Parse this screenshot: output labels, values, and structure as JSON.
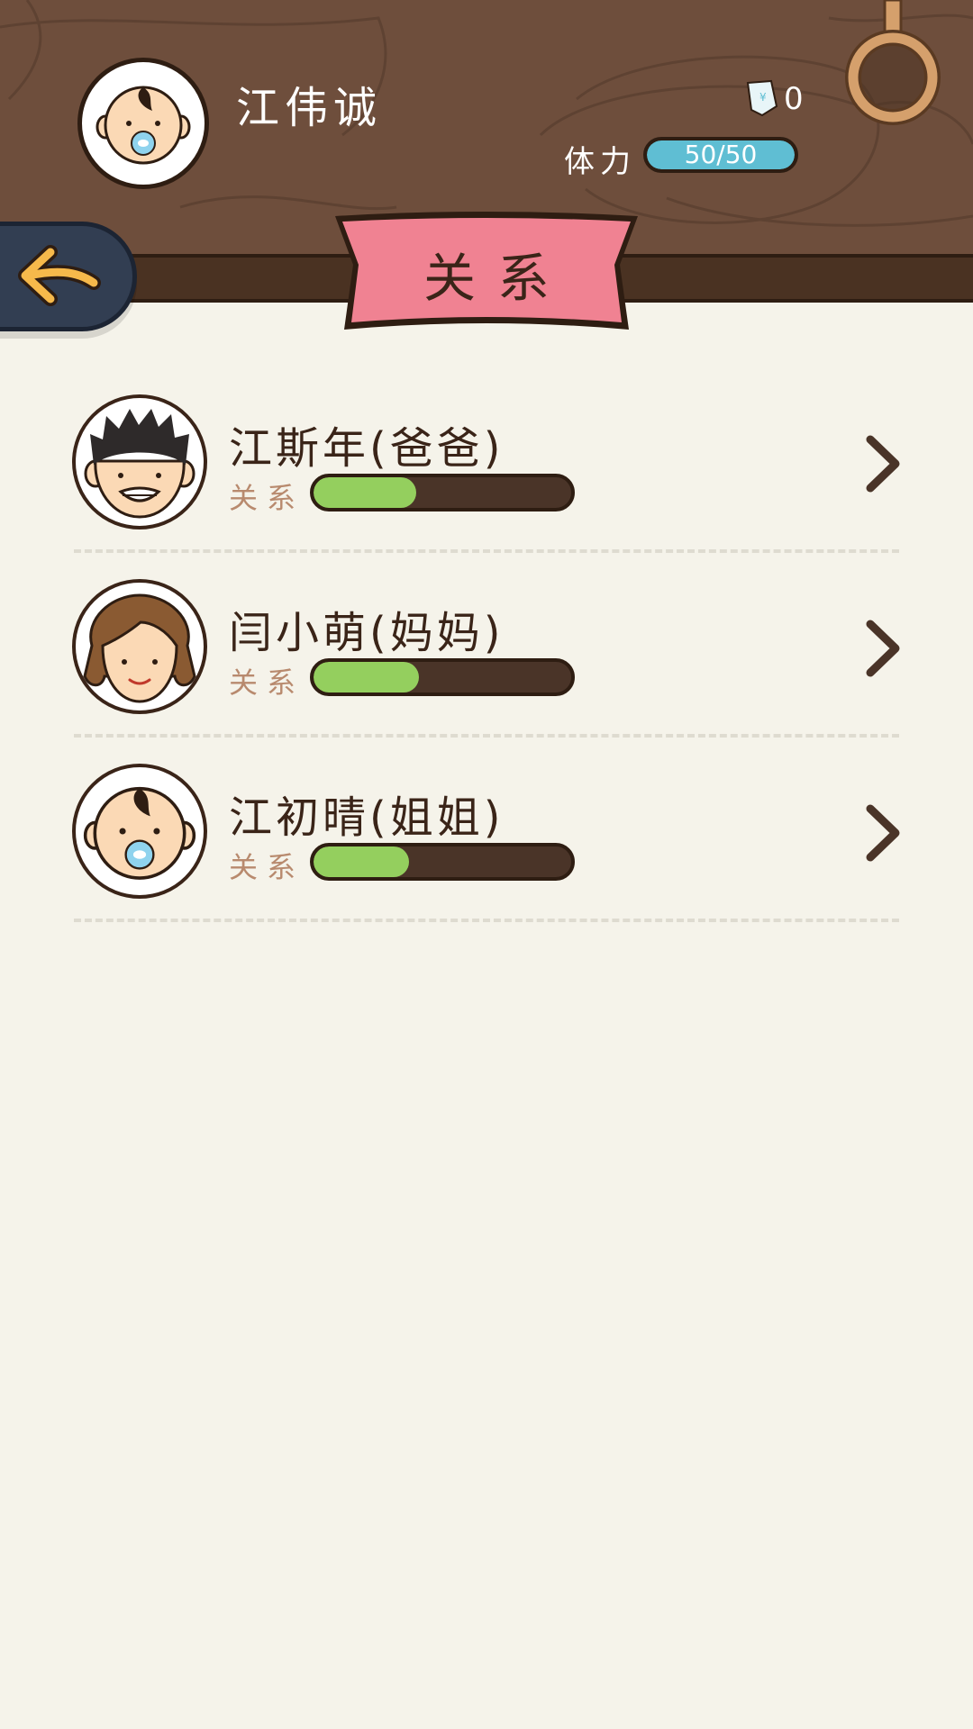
{
  "header": {
    "player_name": "江伟诚",
    "money_count": "0",
    "stamina_label": "体力",
    "stamina_text": "50/50",
    "stamina_fraction": 1.0,
    "title": "关系"
  },
  "relatives": [
    {
      "name": "江斯年(爸爸)",
      "relation_label": "关系",
      "relation_fraction": 0.4,
      "avatar": "dad-face"
    },
    {
      "name": "闫小萌(妈妈)",
      "relation_label": "关系",
      "relation_fraction": 0.41,
      "avatar": "mom-face"
    },
    {
      "name": "江初晴(姐姐)",
      "relation_label": "关系",
      "relation_fraction": 0.37,
      "avatar": "baby-face"
    }
  ],
  "colors": {
    "header_wood": "#6e4e3c",
    "ribbon": "#f08292",
    "stamina": "#5fbed3",
    "relation": "#94cf5e",
    "back_button": "#323e52",
    "back_arrow": "#f6b94b"
  }
}
